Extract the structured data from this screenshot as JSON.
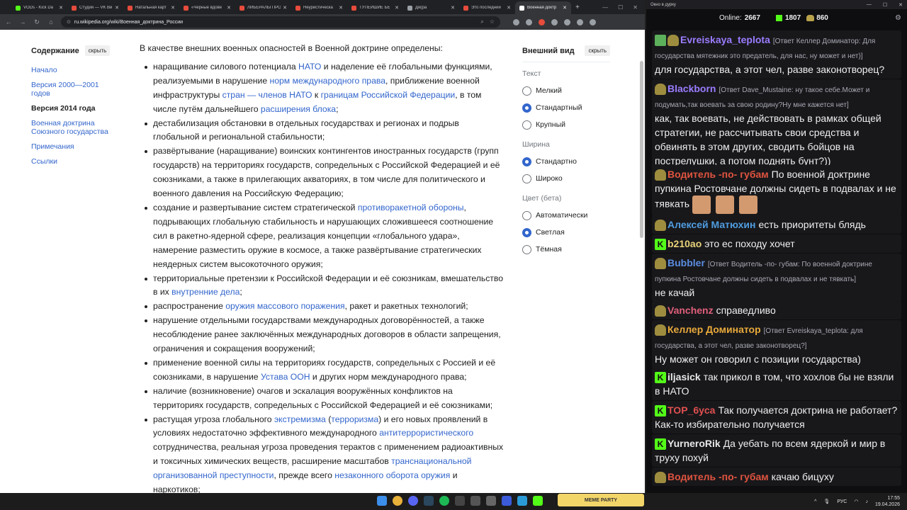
{
  "browser": {
    "tabs": [
      {
        "label": "VODs - Kick Da",
        "color": "#53fc18",
        "active": false
      },
      {
        "label": "Студия — VK Ви",
        "color": "#e74c3c",
        "active": false
      },
      {
        "label": "Натальная карт",
        "color": "#e74c3c",
        "active": false
      },
      {
        "label": "«Черные вдове",
        "color": "#e74c3c",
        "active": false
      },
      {
        "label": "ЛИБЕРАЛЫ ПРО",
        "color": "#e74c3c",
        "active": false
      },
      {
        "label": "Неуристическа",
        "color": "#e74c3c",
        "active": false
      },
      {
        "label": "ТУПЕЙШИЕ БЕ",
        "color": "#e74c3c",
        "active": false
      },
      {
        "label": "Дiк|ра",
        "color": "#9aa0a6",
        "active": false
      },
      {
        "label": "Это последний",
        "color": "#e74c3c",
        "active": false
      },
      {
        "label": "Военная доктр",
        "color": "#ffffff",
        "active": true
      }
    ],
    "url": "ru.wikipedia.org/wiki/Военная_доктрина_России"
  },
  "toc": {
    "title": "Содержание",
    "hide_label": "скрыть",
    "items": [
      {
        "label": "Начало"
      },
      {
        "label": "Версия 2000—2001 годов"
      },
      {
        "label": "Версия 2014 года"
      },
      {
        "label": "Военная доктрина Союзного государства"
      },
      {
        "label": "Примечания"
      },
      {
        "label": "Ссылки"
      }
    ]
  },
  "article": {
    "lead": "В качестве внешних военных опасностей в Военной доктрине определены:",
    "items": [
      [
        [
          "наращивание силового потенциала ",
          false
        ],
        [
          "НАТО",
          true
        ],
        [
          " и наделение её глобальными функциями, реализуемыми в нарушение ",
          false
        ],
        [
          "норм международного права",
          true
        ],
        [
          ", приближение военной инфраструктуры ",
          false
        ],
        [
          "стран — членов НАТО",
          true
        ],
        [
          " к ",
          false
        ],
        [
          "границам Российской Федерации",
          true
        ],
        [
          ", в том числе путём дальнейшего ",
          false
        ],
        [
          "расширения блока",
          true
        ],
        [
          ";",
          false
        ]
      ],
      [
        [
          "дестабилизация обстановки в отдельных государствах и регионах и подрыв глобальной и региональной стабильности;",
          false
        ]
      ],
      [
        [
          "развёртывание (наращивание) воинских контингентов иностранных государств (групп государств) на территориях государств, сопредельных с Российской Федерацией и её союзниками, а также в прилегающих акваториях, в том числе для политического и военного давления на Российскую Федерацию;",
          false
        ]
      ],
      [
        [
          "создание и развертывание систем стратегической ",
          false
        ],
        [
          "противоракетной обороны",
          true
        ],
        [
          ", подрывающих глобальную стабильность и нарушающих сложившееся соотношение сил в ракетно-ядерной сфере, реализация концепции «глобального удара», намерение разместить оружие в космосе, а также развёртывание стратегических неядерных систем высокоточного оружия;",
          false
        ]
      ],
      [
        [
          "территориальные претензии к Российской Федерации и её союзникам, вмешательство в их ",
          false
        ],
        [
          "внутренние дела",
          true
        ],
        [
          ";",
          false
        ]
      ],
      [
        [
          "распространение ",
          false
        ],
        [
          "оружия массового поражения",
          true
        ],
        [
          ", ракет и ракетных технологий;",
          false
        ]
      ],
      [
        [
          "нарушение отдельными государствами международных договорённостей, а также несоблюдение ранее заключённых международных договоров в области запрещения, ограничения и сокращения вооружений;",
          false
        ]
      ],
      [
        [
          "применение военной силы на территориях государств, сопредельных с Россией и её союзниками, в нарушение ",
          false
        ],
        [
          "Устава ООН",
          true
        ],
        [
          " и других норм международного права;",
          false
        ]
      ],
      [
        [
          "наличие (возникновение) очагов и эскалация вооружённых конфликтов на территориях государств, сопредельных с Российской Федерацией и её союзниками;",
          false
        ]
      ],
      [
        [
          "растущая угроза глобального ",
          false
        ],
        [
          "экстремизма",
          true
        ],
        [
          " (",
          false
        ],
        [
          "терроризма",
          true
        ],
        [
          ") и его новых проявлений в условиях недостаточно эффективного международного ",
          false
        ],
        [
          "антитеррористического",
          true
        ],
        [
          " сотрудничества, реальная угроза проведения терактов с применением радиоактивных и токсичных химических веществ, расширение масштабов ",
          false
        ],
        [
          "транснациональной организованной преступности",
          true
        ],
        [
          ", прежде всего ",
          false
        ],
        [
          "незаконного оборота оружия",
          true
        ],
        [
          " и наркотиков;",
          false
        ]
      ]
    ]
  },
  "appearance": {
    "title": "Внешний вид",
    "hide_label": "скрыть",
    "groups": [
      {
        "label": "Текст",
        "options": [
          {
            "label": "Мелкий",
            "on": false
          },
          {
            "label": "Стандартный",
            "on": true
          },
          {
            "label": "Крупный",
            "on": false
          }
        ]
      },
      {
        "label": "Ширина",
        "options": [
          {
            "label": "Стандартно",
            "on": true
          },
          {
            "label": "Широко",
            "on": false
          }
        ]
      },
      {
        "label": "Цвет (бета)",
        "options": [
          {
            "label": "Автоматически",
            "on": false
          },
          {
            "label": "Светлая",
            "on": true
          },
          {
            "label": "Тёмная",
            "on": false
          }
        ]
      }
    ]
  },
  "chat": {
    "window_title": "Окно в дурку",
    "online_label": "Online:",
    "online_value": "2667",
    "kick_count": "1807",
    "other_count": "860",
    "messages": [
      {
        "badges": [
          "check",
          "face"
        ],
        "nick": "Evreiskaya_teplota",
        "color": "#9b7cff",
        "reply": "[Ответ Келлер Доминатор: Для государства мятежник это предатель, для нас, ну может и нет)]",
        "text": "для государства, а этот чел, разве законотворец?",
        "emotes": 0
      },
      {
        "badges": [
          "face"
        ],
        "nick": "Blackborn",
        "color": "#9b7cff",
        "reply": "[Ответ Dave_Mustaine: ну такое себе.Может и подумать,так воевать за свою родину?Ну мне кажется нет]",
        "text": "как, так воевать, не действовать в рамках общей стратегии, не рассчитывать свои средства и обвинять в этом других, сводить бойцов на пострелушки, а потом поднять бунт?))",
        "emotes": 0
      },
      {
        "badges": [
          "face"
        ],
        "nick": "Водитель -по- губам",
        "color": "#e0543f",
        "reply": "",
        "text": "По военной доктрине пупкина Ростовчане должны сидеть в подвалах и не тявкать",
        "emotes": 3
      },
      {
        "badges": [
          "face"
        ],
        "nick": "Алексей Матюхин",
        "color": "#4f9de0",
        "reply": "",
        "text": "есть приоритеты блядь",
        "emotes": 0
      },
      {
        "badges": [
          "kick"
        ],
        "nick": "b210ao",
        "color": "#e8d27a",
        "reply": "",
        "text": "это ес походу хочет",
        "emotes": 0
      },
      {
        "badges": [
          "face"
        ],
        "nick": "Bubbler",
        "color": "#5b8de0",
        "reply": "[Ответ Водитель -по- губам: По военной доктрине пупкина Ростовчане должны сидеть в подвалах и не тявкать]",
        "text": "не качай",
        "emotes": 0
      },
      {
        "badges": [
          "face"
        ],
        "nick": "Vanchenz",
        "color": "#e05f7a",
        "reply": "",
        "text": "справедливо",
        "emotes": 0
      },
      {
        "badges": [
          "face"
        ],
        "nick": "Келлер Доминатор",
        "color": "#e8a93a",
        "reply": "[Ответ Evreiskaya_teplota: для государства, а этот чел, разве законотворец?]",
        "text": "Ну может он говорил с позиции государства)",
        "emotes": 0
      },
      {
        "badges": [
          "kick"
        ],
        "nick": "iljasick",
        "color": "#e8e8e8",
        "reply": "",
        "text": "так прикол в том, что хохлов бы не взяли в НАТО",
        "emotes": 0
      },
      {
        "badges": [
          "kick"
        ],
        "nick": "TOP_6yca",
        "color": "#e05050",
        "reply": "",
        "text": "Так получается доктрина не работает? Как-то избирательно получается",
        "emotes": 0
      },
      {
        "badges": [
          "kick"
        ],
        "nick": "YurneroRik",
        "color": "#e8e8e8",
        "reply": "",
        "text": "Да уебать по всем ядеркой и мир в труху похуй",
        "emotes": 0
      },
      {
        "badges": [
          "face"
        ],
        "nick": "Водитель -по- губам",
        "color": "#e0543f",
        "reply": "",
        "text": "качаю бицуху",
        "emotes": 0
      }
    ]
  },
  "taskbar": {
    "meme_badge": "MEME PARTY",
    "lang": "РУС",
    "time": "17:55",
    "date": "19.04.2026"
  }
}
